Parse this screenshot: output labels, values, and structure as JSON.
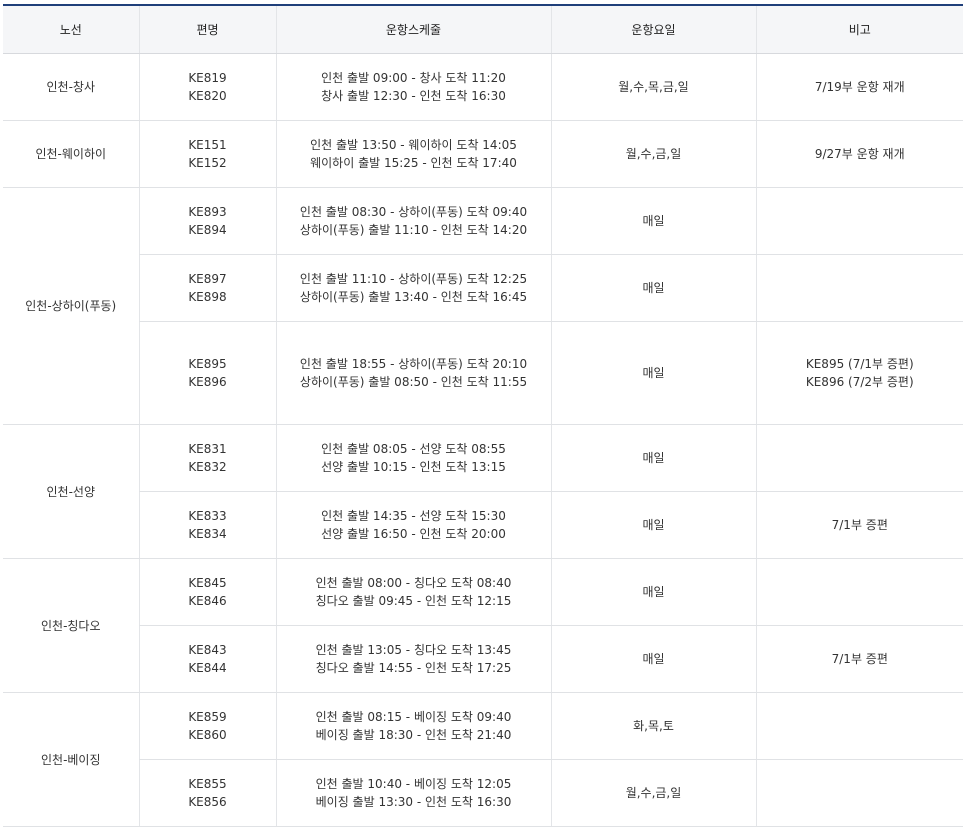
{
  "headers": [
    "노선",
    "편명",
    "운항스케줄",
    "운항요일",
    "비고"
  ],
  "routes": [
    {
      "name": "인천-창사",
      "flights": [
        {
          "nos": [
            "KE819",
            "KE820"
          ],
          "schedule": [
            "인천 출발 09:00 - 창사 도착 11:20",
            "창사 출발 12:30 - 인천 도착 16:30"
          ],
          "days": "월,수,목,금,일",
          "note": [
            "7/19부 운항 재개"
          ]
        }
      ]
    },
    {
      "name": "인천-웨이하이",
      "flights": [
        {
          "nos": [
            "KE151",
            "KE152"
          ],
          "schedule": [
            "인천 출발 13:50 - 웨이하이 도착 14:05",
            "웨이하이 출발 15:25 - 인천 도착 17:40"
          ],
          "days": "월,수,금,일",
          "note": [
            "9/27부 운항 재개"
          ]
        }
      ]
    },
    {
      "name": "인천-상하이(푸동)",
      "flights": [
        {
          "nos": [
            "KE893",
            "KE894"
          ],
          "schedule": [
            "인천 출발 08:30 - 상하이(푸동) 도착 09:40",
            "상하이(푸동) 출발 11:10 - 인천 도착 14:20"
          ],
          "days": "매일",
          "note": []
        },
        {
          "nos": [
            "KE897",
            "KE898"
          ],
          "schedule": [
            "인천 출발 11:10 - 상하이(푸동) 도착 12:25",
            "상하이(푸동) 출발 13:40 - 인천 도착 16:45"
          ],
          "days": "매일",
          "note": []
        },
        {
          "nos": [
            "KE895",
            "KE896"
          ],
          "schedule": [
            "인천 출발 18:55 - 상하이(푸동) 도착 20:10",
            "상하이(푸동) 출발 08:50 - 인천 도착 11:55"
          ],
          "days": "매일",
          "note": [
            "KE895 (7/1부 증편)",
            "KE896 (7/2부 증편)"
          ]
        }
      ]
    },
    {
      "name": "인천-선양",
      "flights": [
        {
          "nos": [
            "KE831",
            "KE832"
          ],
          "schedule": [
            "인천 출발 08:05 - 선양 도착 08:55",
            "선양 출발 10:15 - 인천 도착 13:15"
          ],
          "days": "매일",
          "note": []
        },
        {
          "nos": [
            "KE833",
            "KE834"
          ],
          "schedule": [
            "인천 출발 14:35 - 선양 도착 15:30",
            "선양 출발 16:50 - 인천 도착 20:00"
          ],
          "days": "매일",
          "note": [
            "7/1부 증편"
          ]
        }
      ]
    },
    {
      "name": "인천-칭다오",
      "flights": [
        {
          "nos": [
            "KE845",
            "KE846"
          ],
          "schedule": [
            "인천 출발 08:00 - 칭다오 도착 08:40",
            "칭다오 출발 09:45 - 인천 도착 12:15"
          ],
          "days": "매일",
          "note": []
        },
        {
          "nos": [
            "KE843",
            "KE844"
          ],
          "schedule": [
            "인천 출발 13:05 - 칭다오 도착 13:45",
            "칭다오 출발 14:55 - 인천 도착 17:25"
          ],
          "days": "매일",
          "note": [
            "7/1부 증편"
          ]
        }
      ]
    },
    {
      "name": "인천-베이징",
      "flights": [
        {
          "nos": [
            "KE859",
            "KE860"
          ],
          "schedule": [
            "인천 출발 08:15 - 베이징 도착 09:40",
            "베이징 출발 18:30 - 인천 도착 21:40"
          ],
          "days": "화,목,토",
          "note": []
        },
        {
          "nos": [
            "KE855",
            "KE856"
          ],
          "schedule": [
            "인천 출발 10:40 - 베이징 도착 12:05",
            "베이징 출발 13:30 - 인천 도착 16:30"
          ],
          "days": "월,수,금,일",
          "note": []
        }
      ]
    }
  ],
  "colors": {
    "header_top_border": "#1f3f7a",
    "header_bg": "#f5f6f8",
    "text": "#333333"
  }
}
